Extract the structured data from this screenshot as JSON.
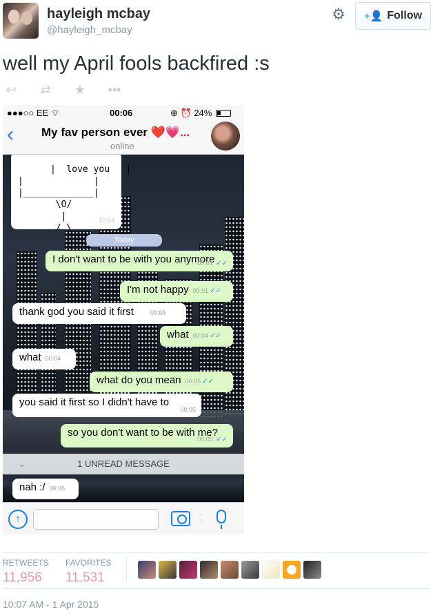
{
  "tweet": {
    "display_name": "hayleigh mcbay",
    "handle": "@hayleigh_mcbay",
    "follow_label": "Follow",
    "text": "well my April fools backfired :s",
    "timestamp": "10:07 AM - 1 Apr 2015"
  },
  "actions": {
    "reply_icon": "reply-icon",
    "retweet_icon": "retweet-icon",
    "favorite_icon": "star-icon",
    "more_icon": "more-icon"
  },
  "stats": {
    "retweets_label": "RETWEETS",
    "retweets_value": "11,956",
    "favorites_label": "FAVORITES",
    "favorites_value": "11,531"
  },
  "phone": {
    "status": {
      "carrier": "●●●○○ EE",
      "time": "00:06",
      "battery": "24%"
    },
    "chat_title": "My fav person ever",
    "chat_title_emoji": "❤️💗...",
    "chat_status": "online",
    "ascii_art": "|  love you   |\n|             |\n|_____________|\n       \\O/\n        |\n       / \\",
    "ascii_time": "23:54",
    "date_label": "Today",
    "messages": [
      {
        "dir": "out",
        "text": "I don't want to be with you anymore",
        "time": "00:01"
      },
      {
        "dir": "out",
        "text": "I'm not happy",
        "time": "00:01"
      },
      {
        "dir": "in",
        "text": "thank god you said it first",
        "time": "00:04"
      },
      {
        "dir": "out",
        "text": "what",
        "time": "00:04"
      },
      {
        "dir": "in",
        "text": "what",
        "time": "00:04"
      },
      {
        "dir": "out",
        "text": "what do you mean",
        "time": "00:05"
      },
      {
        "dir": "in",
        "text": "you said it first so I didn't have to",
        "time": "00:05"
      },
      {
        "dir": "out",
        "text": "so you don't want to be with me?",
        "time": "00:05"
      },
      {
        "dir": "in",
        "text": "nah :/",
        "time": "00:06"
      }
    ],
    "unread_label": "1 UNREAD MESSAGE",
    "ticks": "✓✓"
  },
  "colors": {
    "twitter_blue": "#55acee",
    "stat_pink": "#e99aa6",
    "outgoing_bubble": "#dcf8c6",
    "ios_blue": "#1a7ef3"
  }
}
